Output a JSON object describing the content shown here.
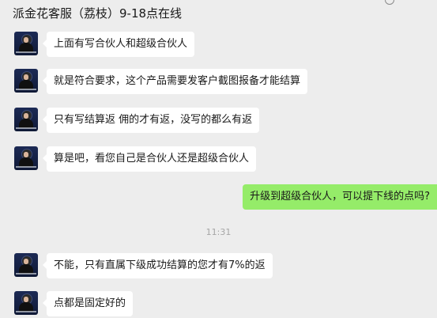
{
  "header": {
    "title": "派金花客服（荔枝）9-18点在线"
  },
  "messages": [
    {
      "side": "left",
      "text": "上面有写合伙人和超级合伙人"
    },
    {
      "side": "left",
      "text": "就是符合要求，这个产品需要发客户截图报备才能结算"
    },
    {
      "side": "left",
      "text": "只有写结算返 佣的才有返，没写的都么有返"
    },
    {
      "side": "left",
      "text": "算是吧，看您自己是合伙人还是超级合伙人"
    },
    {
      "side": "right",
      "text": "升级到超级合伙人，可以提下线的点吗?"
    },
    {
      "side": "left",
      "text": "不能，只有直属下级成功结算的您才有7%的返"
    },
    {
      "side": "left",
      "text": "点都是固定好的"
    }
  ],
  "timestamp": "11:31",
  "colors": {
    "background": "#ededed",
    "incoming_bubble": "#ffffff",
    "outgoing_bubble": "#95ec69",
    "timestamp": "#a6a6a6"
  },
  "icons": {
    "contact_avatar": "contact-avatar",
    "header_indicator": "circle-icon"
  }
}
